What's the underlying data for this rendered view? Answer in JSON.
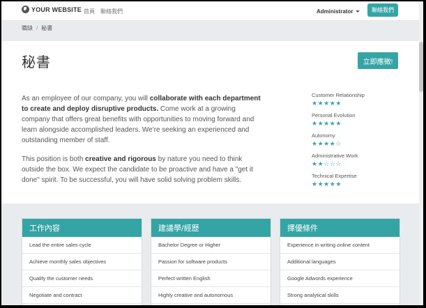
{
  "header": {
    "logo_text": "YOUR WEBSITE",
    "nav": [
      "首頁",
      "聯絡我們"
    ],
    "user": "Administrator",
    "contact_button": "聯絡我們"
  },
  "breadcrumb": [
    "職缺",
    "秘書"
  ],
  "job": {
    "title": "秘書",
    "apply_button": "立即應徵!",
    "description": [
      {
        "segments": [
          {
            "text": "As an employee of our company, you will ",
            "bold": false
          },
          {
            "text": "collaborate with each department to create and deploy disruptive products.",
            "bold": true
          },
          {
            "text": " Come work at a growing company that offers great benefits with opportunities to moving forward and learn alongside accomplished leaders. We're seeking an experienced and outstanding member of staff.",
            "bold": false
          }
        ]
      },
      {
        "segments": [
          {
            "text": "This position is both ",
            "bold": false
          },
          {
            "text": "creative and rigorous",
            "bold": true
          },
          {
            "text": " by nature you need to think outside the box. We expect the candidate to be proactive and have a \"get it done\" spirit. To be successful, you will have solid solving problem skills.",
            "bold": false
          }
        ]
      }
    ]
  },
  "skills": [
    {
      "name": "Customer Relationship",
      "rating": 5,
      "max": 5
    },
    {
      "name": "Personal Evolution",
      "rating": 5,
      "max": 5
    },
    {
      "name": "Autonomy",
      "rating": 4,
      "max": 5
    },
    {
      "name": "Administrative Work",
      "rating": 2,
      "max": 5
    },
    {
      "name": "Technical Expertise",
      "rating": 5,
      "max": 5
    }
  ],
  "cards": [
    {
      "title": "工作內容",
      "items": [
        "Lead the entire sales cycle",
        "Achieve monthly sales objectives",
        "Qualify the customer needs",
        "Negotiate and contract"
      ]
    },
    {
      "title": "建議學/經歷",
      "items": [
        "Bachelor Degree or Higher",
        "Passion for software products",
        "Perfect written English",
        "Highly creative and autonomous"
      ]
    },
    {
      "title": "擇優條件",
      "items": [
        "Experience in writing online content",
        "Additional languages",
        "Google Adwords experience",
        "Strong analytical skills"
      ]
    }
  ],
  "colors": {
    "accent": "#35a4a5",
    "gray_band": "#e9ecef"
  }
}
